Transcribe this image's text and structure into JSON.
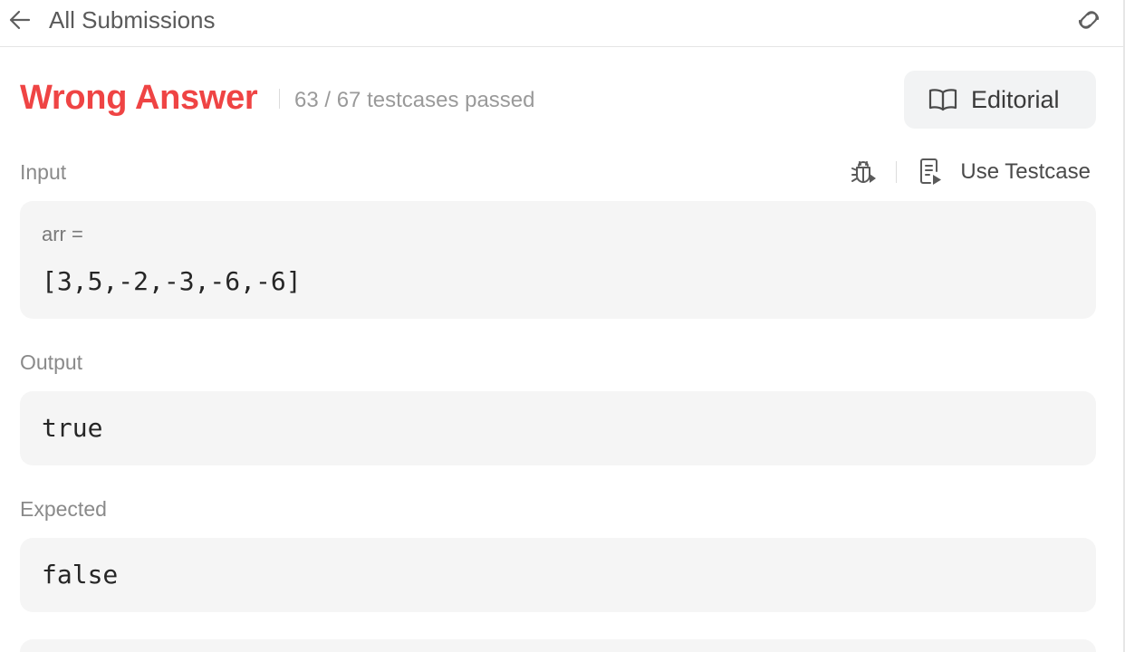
{
  "header": {
    "back_label": "All Submissions",
    "icons": {
      "back": "arrow-left-icon",
      "share": "link-icon"
    }
  },
  "result": {
    "status": "Wrong Answer",
    "passed_text": "63 / 67 testcases passed",
    "status_color": "#ef4444",
    "editorial_label": "Editorial",
    "editorial_icon": "book-open-icon"
  },
  "input_section": {
    "label": "Input",
    "debug_icon": "bug-play-icon",
    "use_testcase_label": "Use Testcase",
    "use_testcase_icon": "file-play-icon",
    "variables": [
      {
        "name": "arr =",
        "value": "[3,5,-2,-3,-6,-6]"
      }
    ]
  },
  "output_section": {
    "label": "Output",
    "value": "true"
  },
  "expected_section": {
    "label": "Expected",
    "value": "false"
  },
  "colors": {
    "box_background": "#f5f5f5",
    "label_gray": "#8a8a8a"
  }
}
